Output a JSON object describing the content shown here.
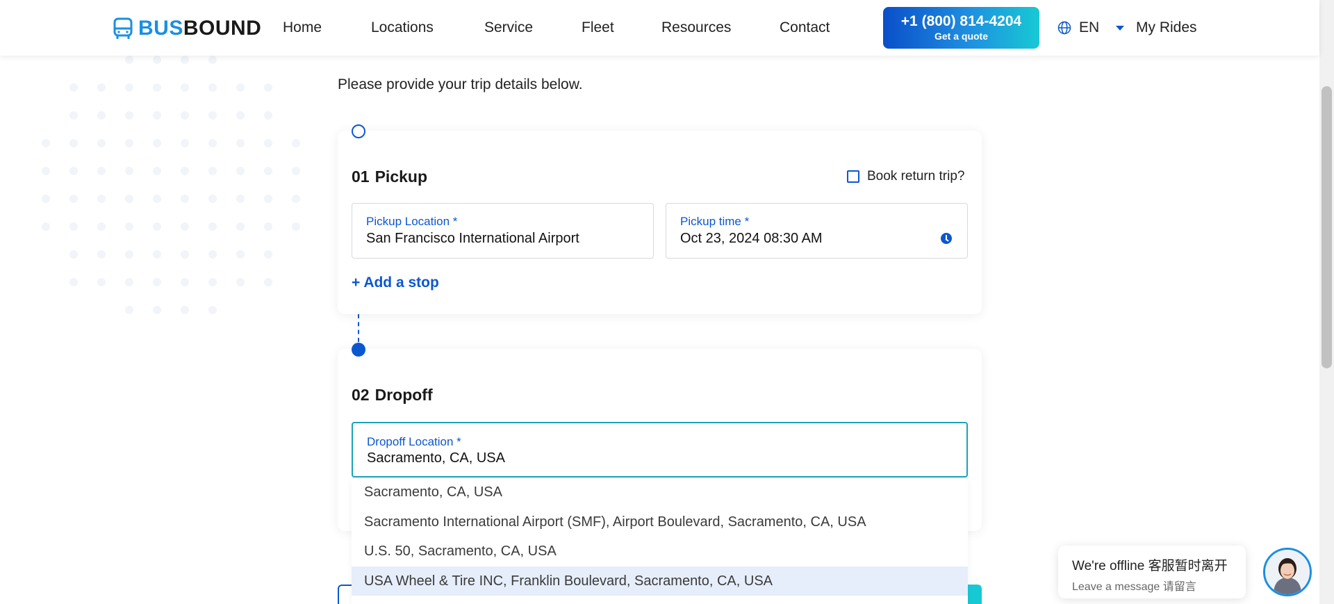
{
  "header": {
    "logo": {
      "part1": "BUS",
      "part2": "BOUND"
    },
    "nav": [
      {
        "label": "Home"
      },
      {
        "label": "Locations"
      },
      {
        "label": "Service"
      },
      {
        "label": "Fleet"
      },
      {
        "label": "Resources"
      },
      {
        "label": "Contact"
      }
    ],
    "cta": {
      "phone": "+1 (800) 814-4204",
      "subtitle": "Get a quote"
    },
    "language": {
      "label": "EN",
      "icon": "globe-icon"
    },
    "my_rides": "My Rides"
  },
  "page": {
    "subtitle": "Please provide your trip details below."
  },
  "pickup": {
    "number": "01",
    "title": "Pickup",
    "return_trip_label": "Book return trip?",
    "return_trip_checked": false,
    "location": {
      "label": "Pickup Location *",
      "value": "San Francisco International Airport"
    },
    "time": {
      "label": "Pickup time *",
      "value": "Oct 23, 2024 08:30 AM"
    },
    "add_stop": "+ Add a stop"
  },
  "dropoff": {
    "number": "02",
    "title": "Dropoff",
    "location": {
      "label": "Dropoff Location *",
      "value": "Sacramento, CA, USA"
    },
    "suggestions": [
      {
        "text": "Sacramento, CA, USA"
      },
      {
        "text": "Sacramento International Airport (SMF), Airport Boulevard, Sacramento, CA, USA"
      },
      {
        "text": "U.S. 50, Sacramento, CA, USA"
      },
      {
        "text": "USA Wheel & Tire INC, Franklin Boulevard, Sacramento, CA, USA"
      }
    ],
    "highlighted_suggestion_index": 3
  },
  "chat": {
    "status": "We're offline 客服暂时离开",
    "prompt": "Leave a message 请留言"
  },
  "colors": {
    "primary": "#0b57d0",
    "brand_blue": "#1a8fe0",
    "accent_teal": "#17c9d4",
    "highlight_bg": "#e6eefb"
  }
}
